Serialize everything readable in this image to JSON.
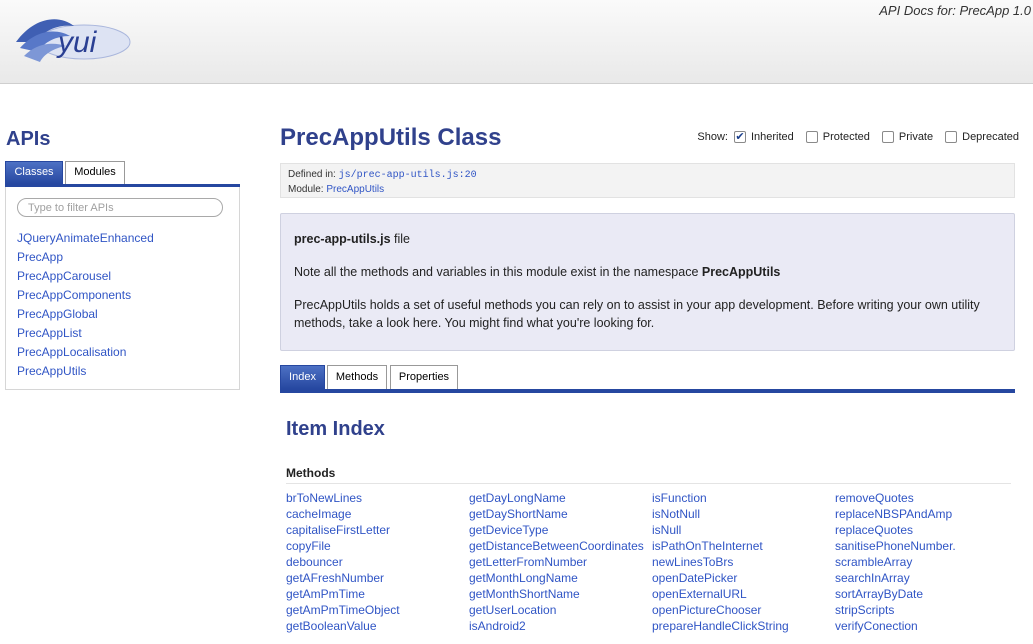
{
  "header": {
    "logo_text": "yui",
    "title": "API Docs for: PrecApp 1.0"
  },
  "sidebar": {
    "title": "APIs",
    "tabs": [
      {
        "label": "Classes",
        "active": true
      },
      {
        "label": "Modules",
        "active": false
      }
    ],
    "filter_placeholder": "Type to filter APIs",
    "classes": [
      "JQueryAnimateEnhanced",
      "PrecApp",
      "PrecAppCarousel",
      "PrecAppComponents",
      "PrecAppGlobal",
      "PrecAppList",
      "PrecAppLocalisation",
      "PrecAppUtils"
    ]
  },
  "main": {
    "class_title": "PrecAppUtils Class",
    "show": {
      "label": "Show:",
      "options": [
        {
          "label": "Inherited",
          "checked": true
        },
        {
          "label": "Protected",
          "checked": false
        },
        {
          "label": "Private",
          "checked": false
        },
        {
          "label": "Deprecated",
          "checked": false
        }
      ]
    },
    "defined_in_label": "Defined in:",
    "defined_in_value": "js/prec-app-utils.js:20",
    "module_label": "Module:",
    "module_value": "PrecAppUtils",
    "description": {
      "file_name": "prec-app-utils.js",
      "file_suffix": " file",
      "note_prefix": "Note all the methods and variables in this module exist in the namespace ",
      "note_namespace": "PrecAppUtils",
      "body": "PrecAppUtils holds a set of useful methods you can rely on to assist in your app development. Before writing your own utility methods, take a look here. You might find what you're looking for."
    },
    "tabs": [
      {
        "label": "Index",
        "active": true
      },
      {
        "label": "Methods",
        "active": false
      },
      {
        "label": "Properties",
        "active": false
      }
    ],
    "item_index_title": "Item Index",
    "methods_heading": "Methods",
    "methods": [
      "brToNewLines",
      "cacheImage",
      "capitaliseFirstLetter",
      "copyFile",
      "debouncer",
      "getAFreshNumber",
      "getAmPmTime",
      "getAmPmTimeObject",
      "getBooleanValue",
      "getDayLongName",
      "getDayShortName",
      "getDeviceType",
      "getDistanceBetweenCoordinates",
      "getLetterFromNumber",
      "getMonthLongName",
      "getMonthShortName",
      "getUserLocation",
      "isAndroid2",
      "isFunction",
      "isNotNull",
      "isNull",
      "isPathOnTheInternet",
      "newLinesToBrs",
      "openDatePicker",
      "openExternalURL",
      "openPictureChooser",
      "prepareHandleClickString",
      "removeQuotes",
      "replaceNBSPAndAmp",
      "replaceQuotes",
      "sanitisePhoneNumber.",
      "scrambleArray",
      "searchInArray",
      "sortArrayByDate",
      "stripScripts",
      "verifyConection"
    ]
  },
  "colors": {
    "accent": "#2647a0",
    "title": "#30418c",
    "link": "#3055c5",
    "desc_bg": "#eaeaf5"
  }
}
